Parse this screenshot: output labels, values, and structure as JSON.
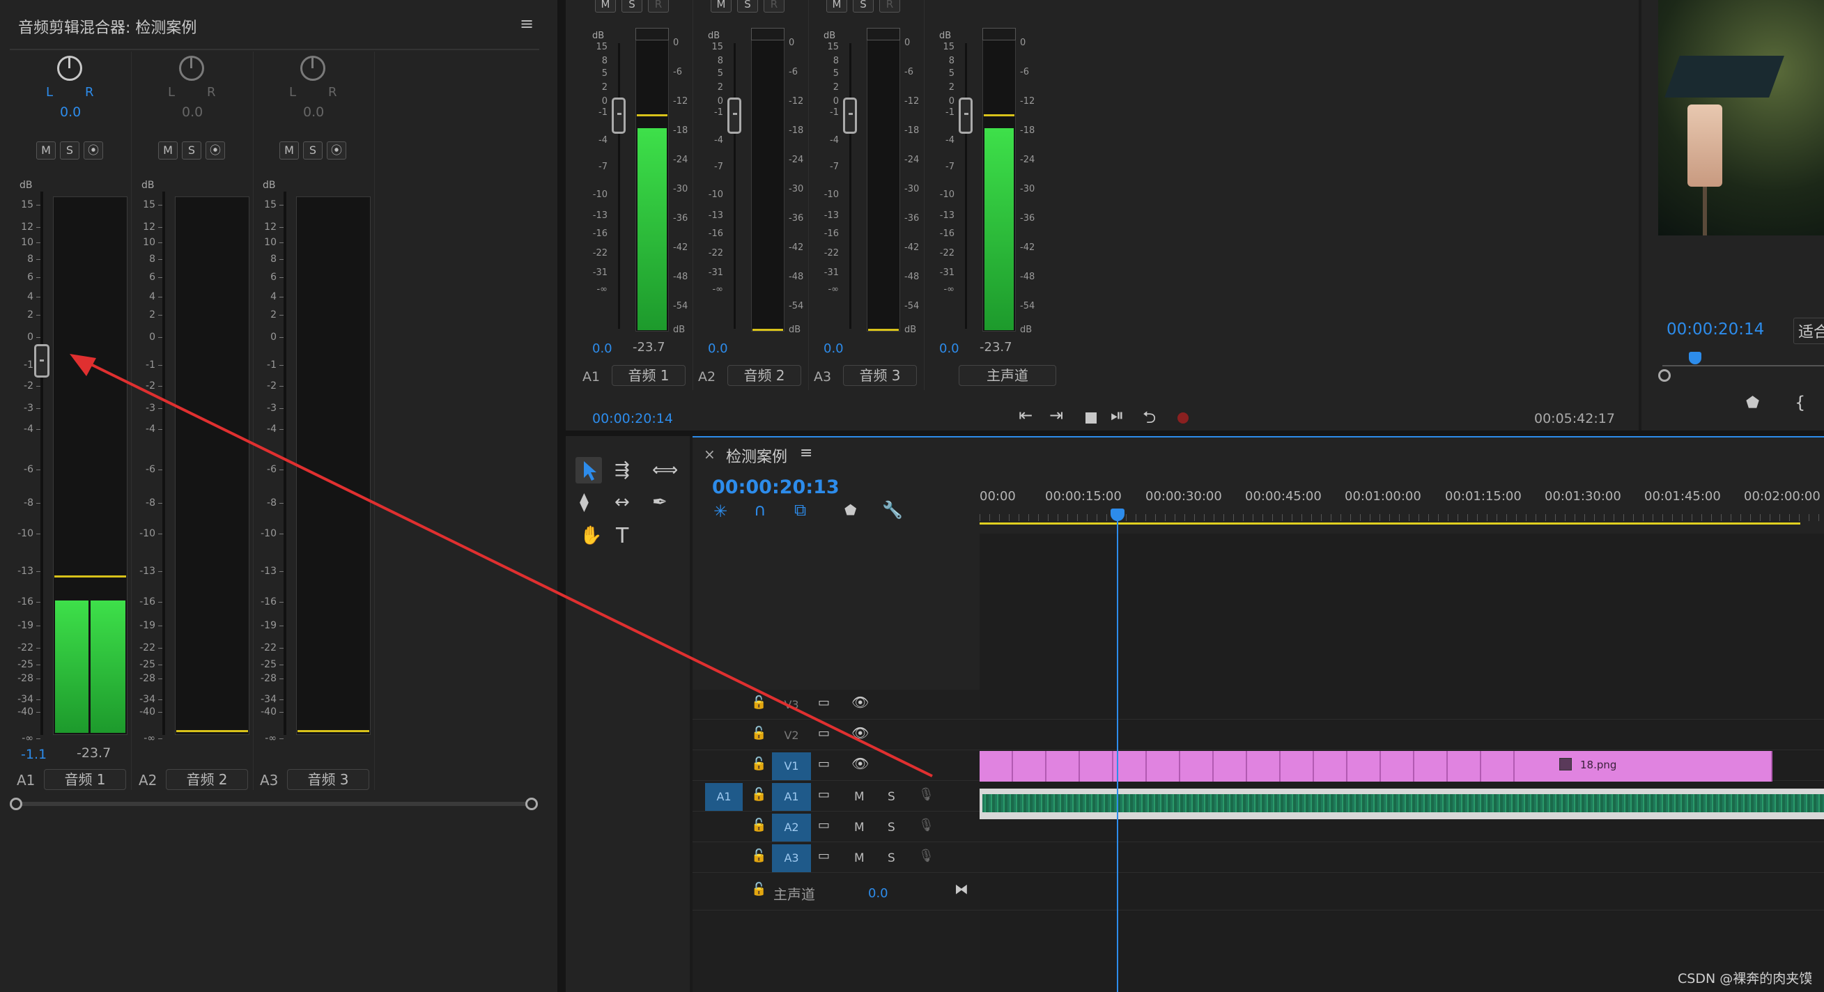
{
  "mixer": {
    "title": "音频剪辑混合器: 检测案例",
    "menu_icon": "≡",
    "channels": [
      {
        "id": "A1",
        "name": "音频 1",
        "pan": "0.0",
        "value": "-1.1",
        "peak": "-23.7"
      },
      {
        "id": "A2",
        "name": "音频 2",
        "pan": "0.0",
        "value": "",
        "peak": ""
      },
      {
        "id": "A3",
        "name": "音频 3",
        "pan": "0.0",
        "value": "",
        "peak": ""
      }
    ],
    "lr": {
      "l": "L",
      "r": "R"
    },
    "buttons": {
      "m": "M",
      "s": "S"
    },
    "db": "dB",
    "left_ticks": [
      "15",
      "12",
      "10",
      "8",
      "6",
      "4",
      "2",
      "0",
      "-1",
      "-2",
      "-3",
      "-4",
      "-6",
      "-8",
      "-10",
      "-13",
      "-16",
      "-19",
      "-22",
      "-25",
      "-28",
      "-34",
      "-40",
      "-∞"
    ]
  },
  "track_mixer": {
    "channels": [
      {
        "id": "A1",
        "name": "音频 1",
        "value": "0.0",
        "peak": "-23.7"
      },
      {
        "id": "A2",
        "name": "音频 2",
        "value": "0.0",
        "peak": ""
      },
      {
        "id": "A3",
        "name": "音频 3",
        "value": "0.0",
        "peak": ""
      },
      {
        "id": "",
        "name": "主声道",
        "value": "0.0",
        "peak": "-23.7"
      }
    ],
    "left_ticks": [
      "15",
      "8",
      "5",
      "2",
      "0",
      "-1",
      "-4",
      "-7",
      "-10",
      "-13",
      "-16",
      "-22",
      "-31",
      "-∞"
    ],
    "right_ticks": [
      "0",
      "-6",
      "-12",
      "-18",
      "-24",
      "-30",
      "-36",
      "-42",
      "-48",
      "-54",
      "dB"
    ],
    "timecode_left": "00:00:20:14",
    "timecode_right": "00:05:42:17"
  },
  "program": {
    "timecode": "00:00:20:14",
    "fit_label": "适合"
  },
  "timeline": {
    "tab_title": "检测案例",
    "close": "×",
    "menu_icon": "≡",
    "timecode": "00:00:20:13",
    "ruler": [
      "00:00",
      "00:00:15:00",
      "00:00:30:00",
      "00:00:45:00",
      "00:01:00:00",
      "00:01:15:00",
      "00:01:30:00",
      "00:01:45:00",
      "00:02:00:00"
    ],
    "video_tracks": [
      "V3",
      "V2",
      "V1"
    ],
    "audio_tracks": [
      "A1",
      "A2",
      "A3"
    ],
    "source_patch": "A1",
    "master_label": "主声道",
    "master_value": "0.0",
    "clip_name": "18.png",
    "m": "M",
    "s": "S"
  },
  "watermark": "CSDN @裸奔的肉夹馍",
  "colors": {
    "accent": "#2d8ceb",
    "clip_video": "#e083e0",
    "clip_audio": "#1f7a5a",
    "meter": "#3ee04a",
    "arrow": "#e03030"
  }
}
